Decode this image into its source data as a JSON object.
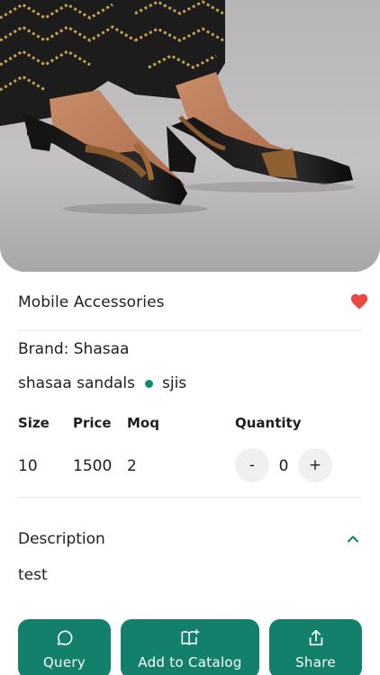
{
  "product": {
    "image_alt": "product-photo",
    "title": "Mobile Accessories",
    "brand": "Brand: Shasaa",
    "tags": [
      "shasaa sandals",
      "sjis"
    ],
    "favorite_color": "#e84a3f",
    "accent_color": "#12806a"
  },
  "variants": {
    "headers": {
      "size": "Size",
      "price": "Price",
      "moq": "Moq",
      "quantity": "Quantity"
    },
    "row": {
      "size": "10",
      "price": "1500",
      "moq": "2"
    },
    "stepper": {
      "minus": "-",
      "value": "0",
      "plus": "+"
    }
  },
  "description": {
    "heading": "Description",
    "text": "test",
    "expanded": true
  },
  "actions": {
    "query": {
      "label": "Query",
      "icon": "chat-bubble-icon"
    },
    "catalog": {
      "label": "Add to Catalog",
      "icon": "book-add-icon"
    },
    "share": {
      "label": "Share",
      "icon": "share-icon"
    }
  }
}
